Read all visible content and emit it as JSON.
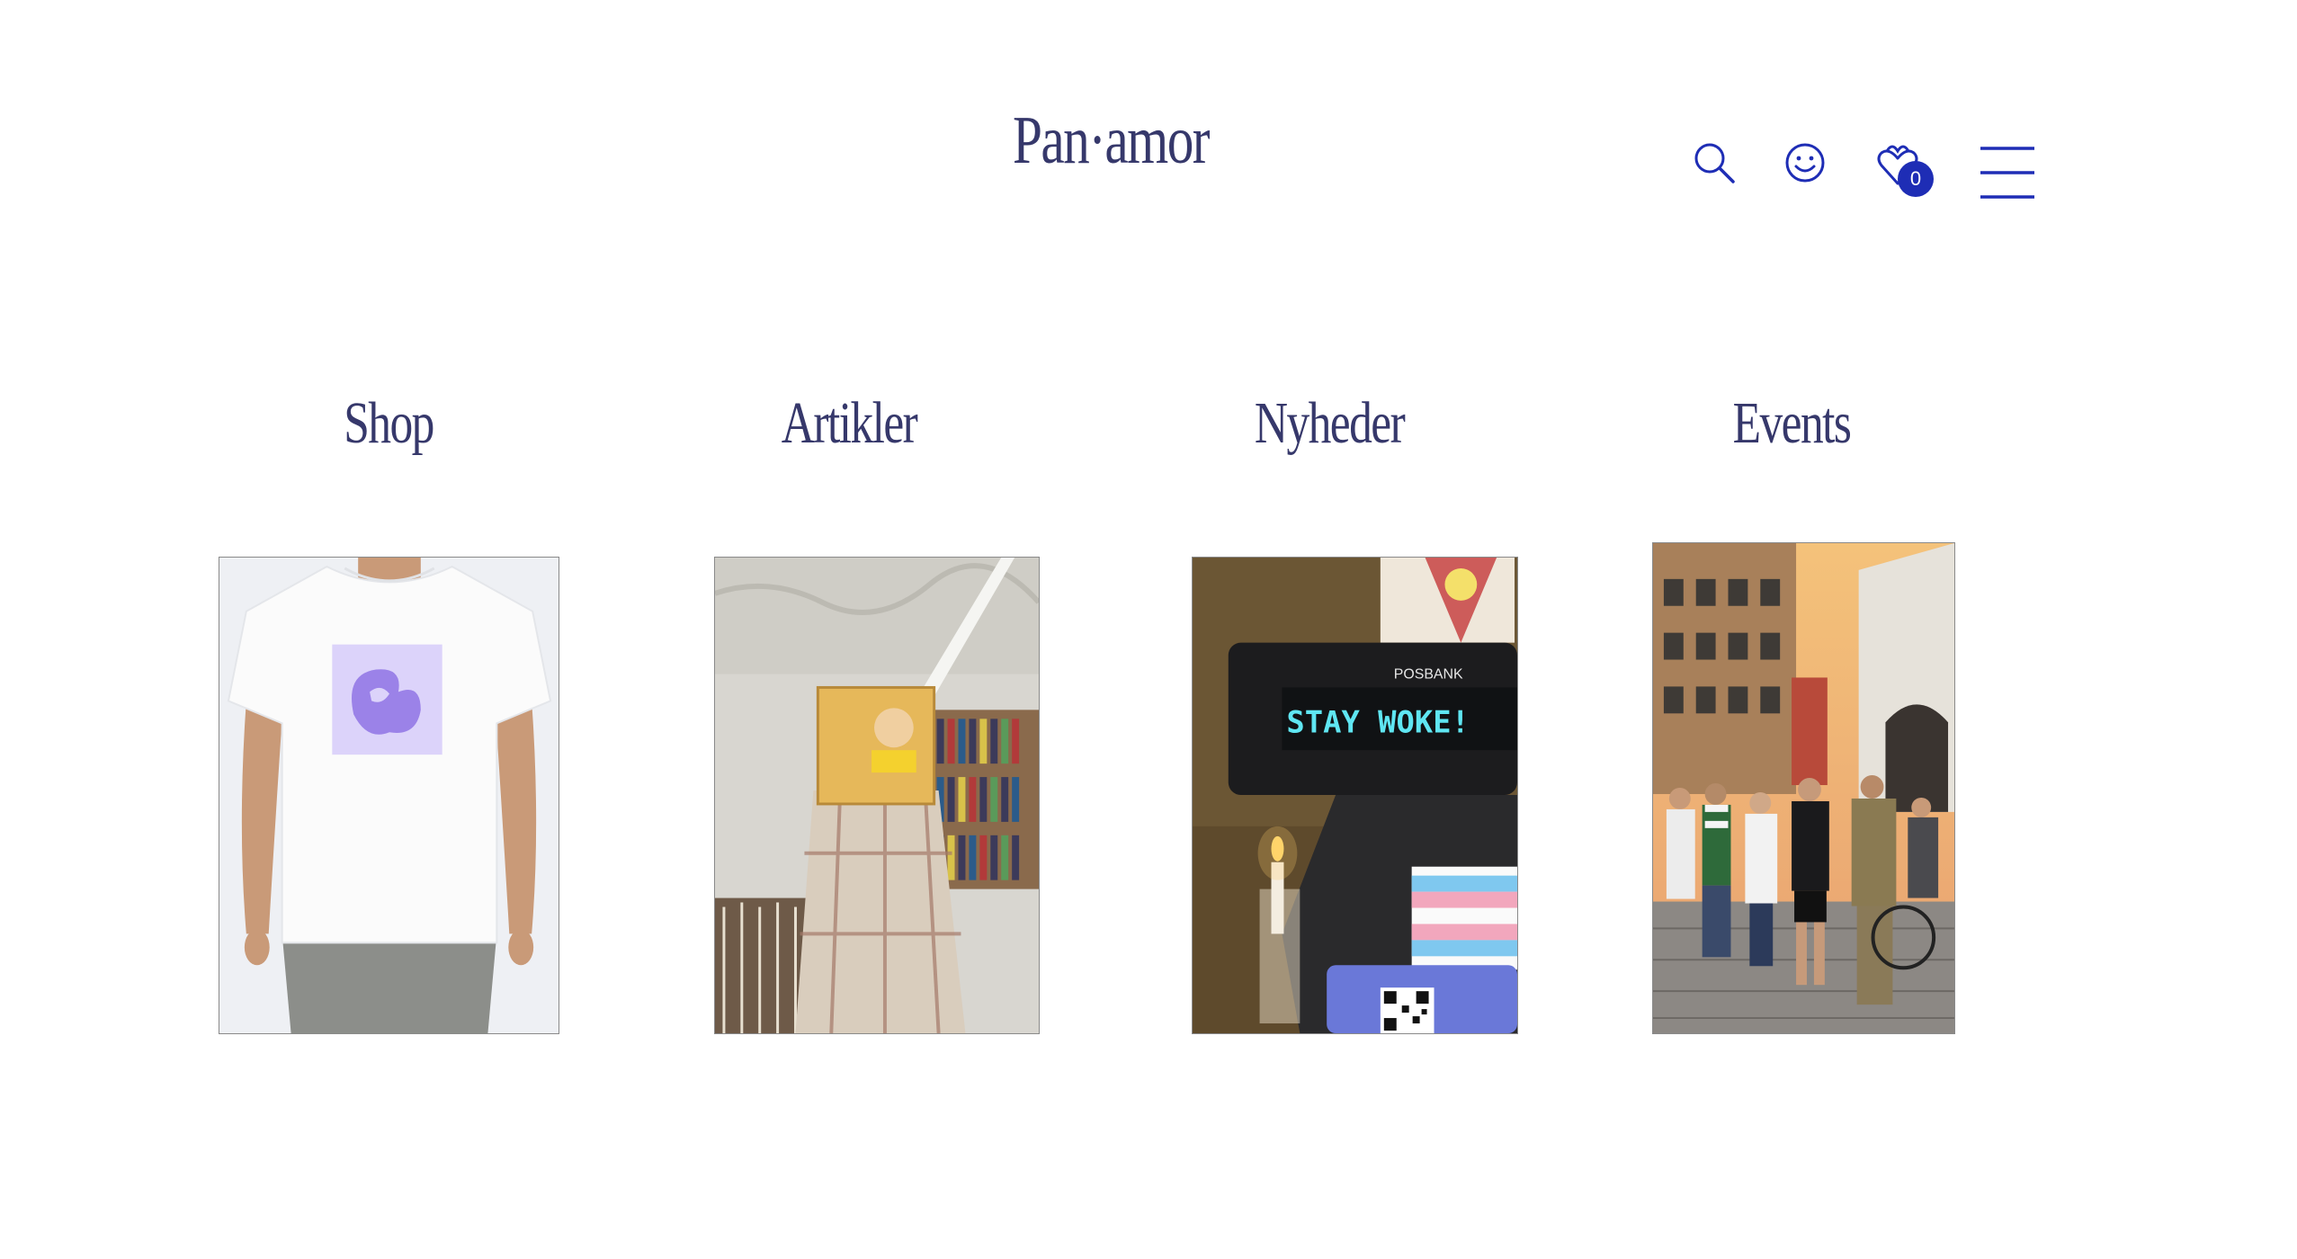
{
  "header": {
    "logo": "Pan·amor",
    "cart_count": "0",
    "icons": [
      "search-icon",
      "account-smiley-icon",
      "cart-heart-icon",
      "hamburger-menu-icon"
    ],
    "accent_color": "#1e2db5",
    "brand_text_color": "#36386b"
  },
  "sections": [
    {
      "title": "Shop"
    },
    {
      "title": "Artikler"
    },
    {
      "title": "Nyheder"
    },
    {
      "title": "Events"
    }
  ],
  "photo_text": {
    "pos_brand": "POSBANK",
    "lcd_message": "STAY WOKE!"
  }
}
